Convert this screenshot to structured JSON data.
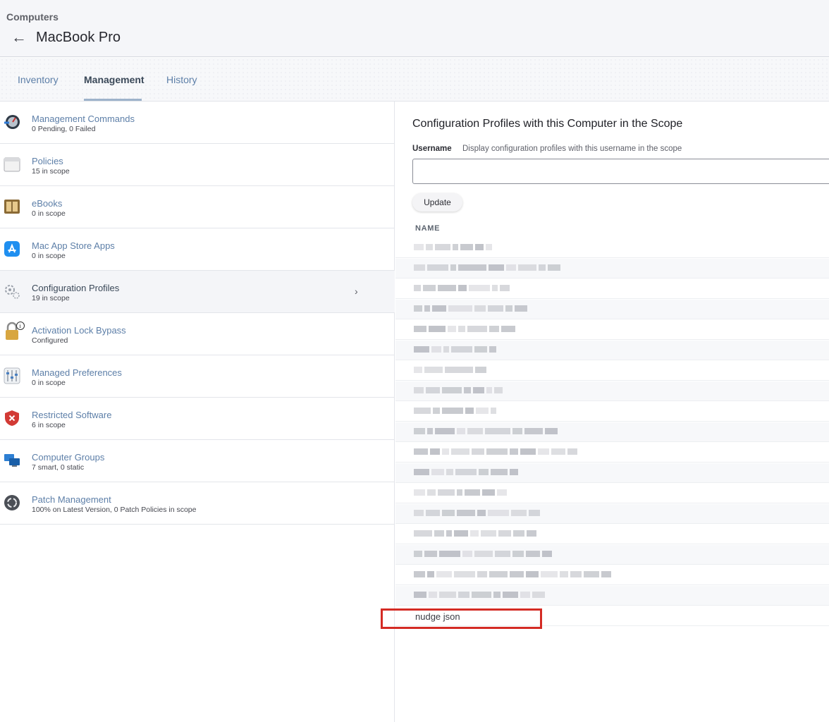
{
  "header": {
    "breadcrumb": "Computers",
    "title": "MacBook Pro"
  },
  "tabs": [
    {
      "label": "Inventory",
      "active": false
    },
    {
      "label": "Management",
      "active": true
    },
    {
      "label": "History",
      "active": false
    }
  ],
  "sidebar": {
    "items": [
      {
        "label": "Management Commands",
        "sub": "0 Pending, 0 Failed",
        "icon": "management-commands-icon"
      },
      {
        "label": "Policies",
        "sub": "15 in scope",
        "icon": "policies-icon"
      },
      {
        "label": "eBooks",
        "sub": "0 in scope",
        "icon": "ebooks-icon"
      },
      {
        "label": "Mac App Store Apps",
        "sub": "0 in scope",
        "icon": "app-store-icon"
      },
      {
        "label": "Configuration Profiles",
        "sub": "19 in scope",
        "icon": "gear-icon",
        "active": true
      },
      {
        "label": "Activation Lock Bypass",
        "sub": "Configured",
        "icon": "lock-icon"
      },
      {
        "label": "Managed Preferences",
        "sub": "0 in scope",
        "icon": "sliders-icon"
      },
      {
        "label": "Restricted Software",
        "sub": "6 in scope",
        "icon": "shield-icon"
      },
      {
        "label": "Computer Groups",
        "sub": "7 smart, 0 static",
        "icon": "computer-groups-icon"
      },
      {
        "label": "Patch Management",
        "sub": "100% on Latest Version, 0 Patch Policies in scope",
        "icon": "patch-icon"
      }
    ]
  },
  "main": {
    "section_title": "Configuration Profiles with this Computer in the Scope",
    "username_label": "Username",
    "username_hint": "Display configuration profiles with this username in the scope",
    "username_value": "",
    "update_label": "Update",
    "column_header": "NAME",
    "last_profile_name": "nudge json",
    "redacted_row_count": 18
  },
  "colors": {
    "link": "#5d7fa8",
    "highlight_border": "#d42b24"
  }
}
